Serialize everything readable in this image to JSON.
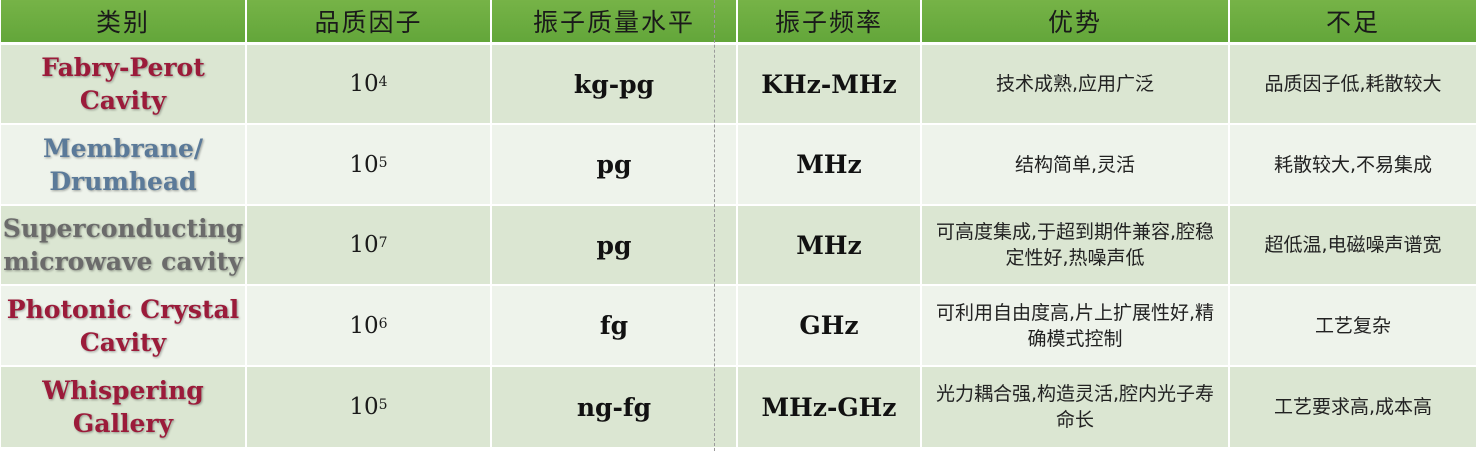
{
  "table": {
    "headers": [
      "类别",
      "品质因子",
      "振子质量水平",
      "振子频率",
      "优势",
      "不足"
    ],
    "rows": [
      {
        "name": "Fabry-Perot Cavity",
        "name_lines": [
          "Fabry-Perot",
          "Cavity"
        ],
        "name_color": "#9b1b3a",
        "q_base": "10",
        "q_exp": "4",
        "mass": "kg-pg",
        "freq": "KHz-MHz",
        "adv": "技术成熟,应用广泛",
        "dis": "品质因子低,耗散较大"
      },
      {
        "name": "Membrane/ Drumhead",
        "name_lines": [
          "Membrane/",
          "Drumhead"
        ],
        "name_color": "#5b7a99",
        "q_base": "10",
        "q_exp": "5",
        "mass": "pg",
        "freq": "MHz",
        "adv": "结构简单,灵活",
        "dis": "耗散较大,不易集成"
      },
      {
        "name": "Superconducting microwave cavity",
        "name_lines": [
          "Superconducting",
          "microwave cavity"
        ],
        "name_color": "#6b6b6b",
        "q_base": "10",
        "q_exp": "7",
        "mass": "pg",
        "freq": "MHz",
        "adv": "可高度集成,于超到期件兼容,腔稳定性好,热噪声低",
        "dis": "超低温,电磁噪声谱宽"
      },
      {
        "name": "Photonic Crystal Cavity",
        "name_lines": [
          "Photonic Crystal",
          "Cavity"
        ],
        "name_color": "#9b1b3a",
        "q_base": "10",
        "q_exp": "6",
        "mass": "fg",
        "freq": "GHz",
        "adv": "可利用自由度高,片上扩展性好,精确模式控制",
        "dis": "工艺复杂"
      },
      {
        "name": "Whispering Gallery",
        "name_lines": [
          "Whispering",
          "Gallery"
        ],
        "name_color": "#9b1b3a",
        "q_base": "10",
        "q_exp": "5",
        "mass": "ng-fg",
        "freq": "MHz-GHz",
        "adv": "光力耦合强,构造灵活,腔内光子寿命长",
        "dis": "工艺要求高,成本高"
      }
    ]
  },
  "colors": {
    "header_bg": "#6aa84f",
    "row_dark": "#dbe6d2",
    "row_light": "#eef3eb",
    "accent_red": "#9b1b3a",
    "accent_blue": "#5b7a99",
    "accent_gray": "#6b6b6b"
  }
}
